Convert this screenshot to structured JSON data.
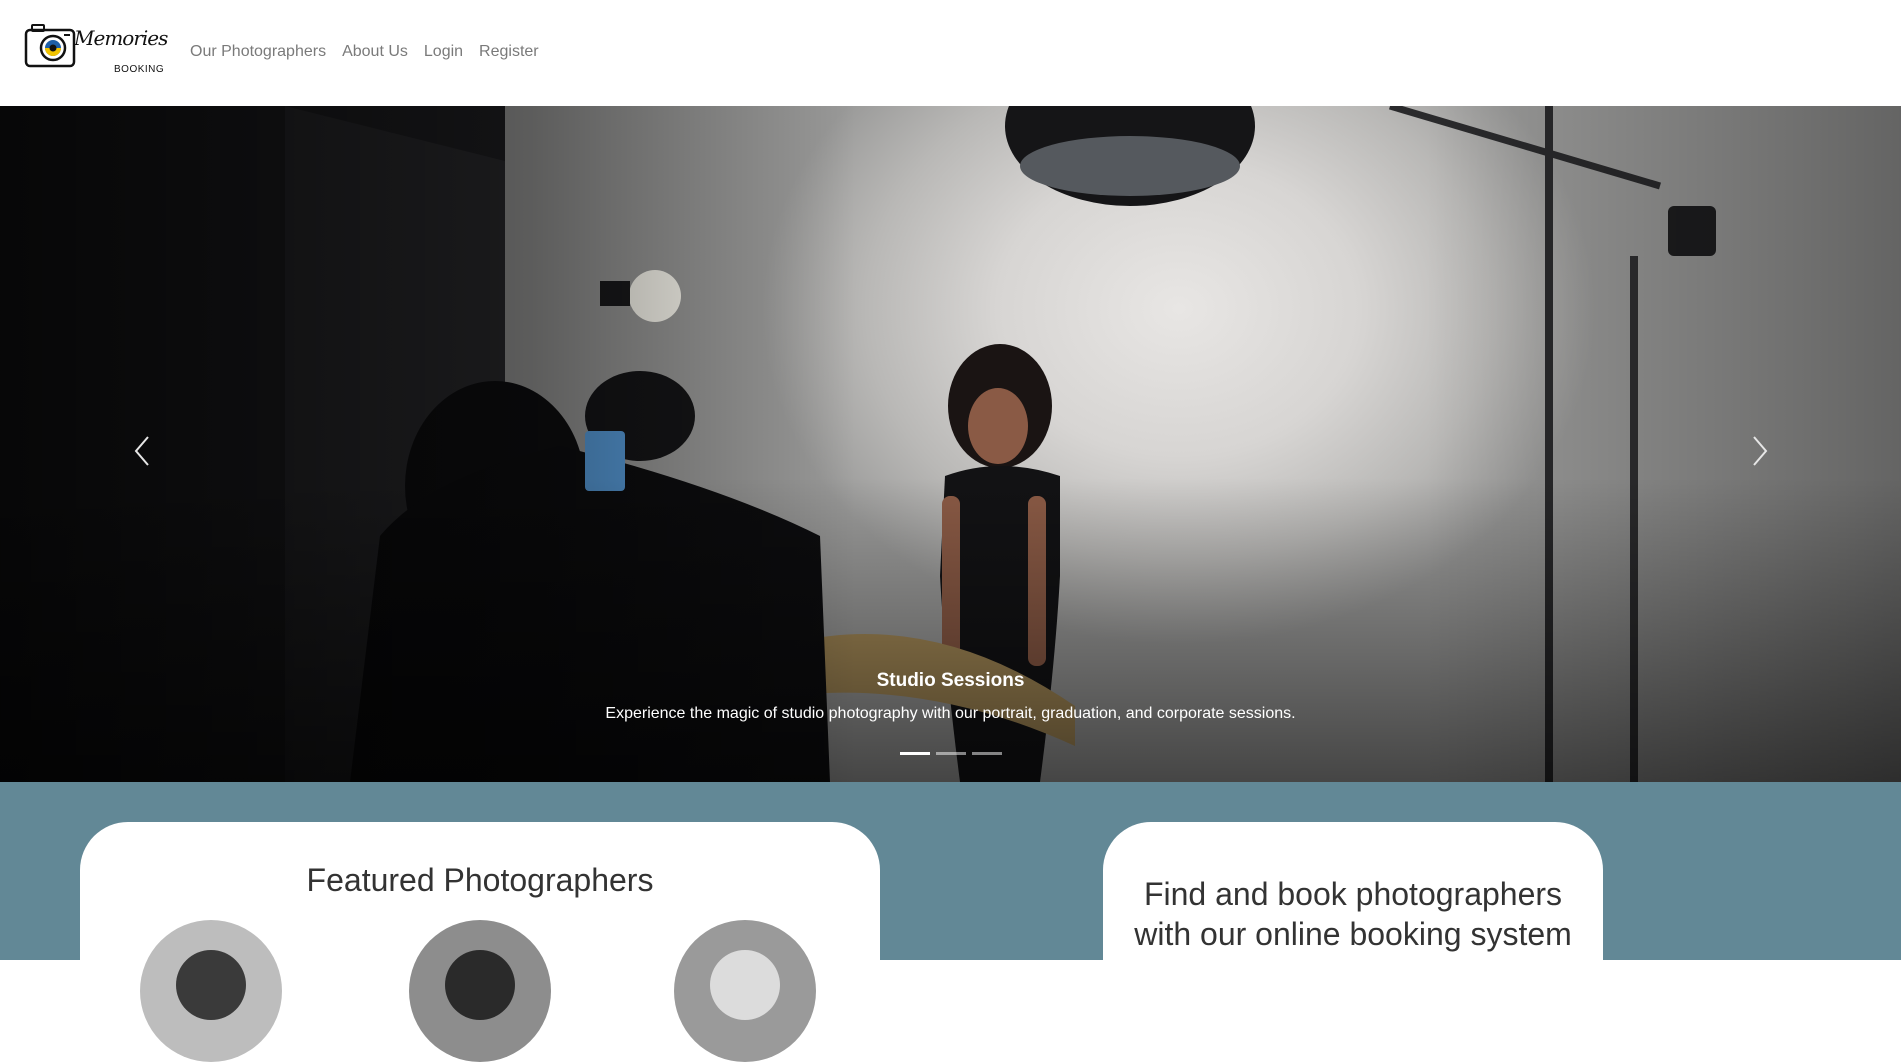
{
  "brand": {
    "name_script": "Memories",
    "name_sub": "BOOKING"
  },
  "nav": {
    "items": [
      {
        "label": "Our Photographers"
      },
      {
        "label": "About Us"
      },
      {
        "label": "Login"
      },
      {
        "label": "Register"
      }
    ]
  },
  "carousel": {
    "caption_title": "Studio Sessions",
    "caption_text": "Experience the magic of studio photography with our portrait, graduation, and corporate sessions.",
    "slide_count": 3,
    "active_index": 0,
    "prev_icon": "chevron-left-icon",
    "next_icon": "chevron-right-icon"
  },
  "featured": {
    "title": "Featured Photographers"
  },
  "find": {
    "title": "Find and book photographers with our online booking system"
  },
  "colors": {
    "section_bg": "#628896",
    "nav_link": "#7a7a7a",
    "heading": "#333333"
  }
}
